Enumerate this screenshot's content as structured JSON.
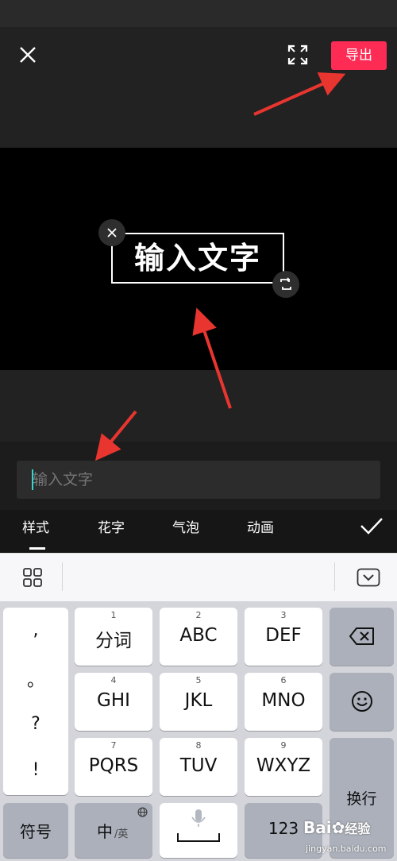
{
  "header": {
    "export_label": "导出"
  },
  "preview": {
    "overlay_text": "输入文字"
  },
  "input": {
    "placeholder": "输入文字"
  },
  "tabs": [
    {
      "label": "样式"
    },
    {
      "label": "花字"
    },
    {
      "label": "气泡"
    },
    {
      "label": "动画"
    }
  ],
  "keyboard": {
    "punct": [
      ",",
      "。",
      "?",
      "!"
    ],
    "rows": [
      [
        {
          "num": "1",
          "label": "分词"
        },
        {
          "num": "2",
          "label": "ABC"
        },
        {
          "num": "3",
          "label": "DEF"
        }
      ],
      [
        {
          "num": "4",
          "label": "GHI"
        },
        {
          "num": "5",
          "label": "JKL"
        },
        {
          "num": "6",
          "label": "MNO"
        }
      ],
      [
        {
          "num": "7",
          "label": "PQRS"
        },
        {
          "num": "8",
          "label": "TUV"
        },
        {
          "num": "9",
          "label": "WXYZ"
        }
      ]
    ],
    "symbols_label": "符号",
    "lang_label": "中",
    "lang_alt": "/英",
    "number_label": "123",
    "enter_label": "换行"
  },
  "watermark": {
    "brand": "Bai",
    "brand2": "经验",
    "url": "jingyan.baidu.com"
  },
  "colors": {
    "accent": "#fe2c55",
    "cursor": "#35d6d0",
    "annotation_arrow": "#e8352f"
  }
}
